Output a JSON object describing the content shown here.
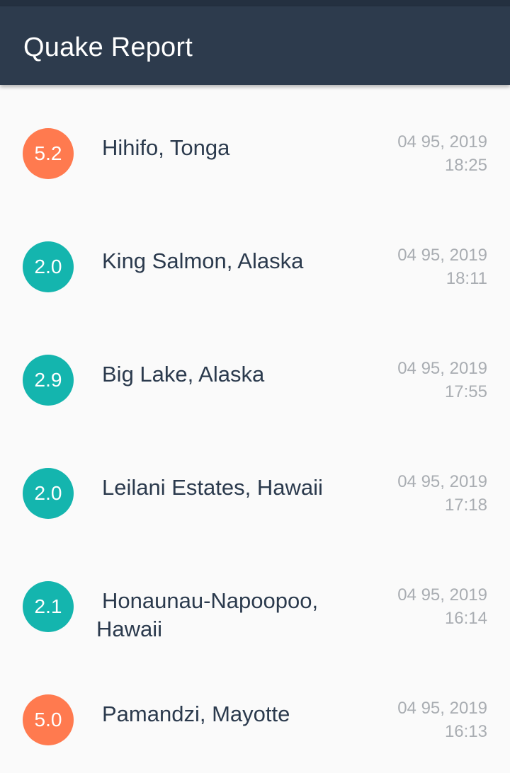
{
  "app": {
    "title": "Quake Report",
    "colors": {
      "app_bar": "#2d3b4d",
      "background": "#fafafa",
      "magnitude_orange": "#ff7a4f",
      "magnitude_teal": "#14b5ae",
      "place_text": "#2b3a4d",
      "date_text": "#a9adb2"
    }
  },
  "earthquakes": [
    {
      "magnitude": "5.2",
      "location": "Hihifo, Tonga",
      "date": "04 95, 2019",
      "time": "18:25",
      "color": "#ff7a4f"
    },
    {
      "magnitude": "2.0",
      "location": "King Salmon, Alaska",
      "date": "04 95, 2019",
      "time": "18:11",
      "color": "#14b5ae"
    },
    {
      "magnitude": "2.9",
      "location": "Big Lake, Alaska",
      "date": "04 95, 2019",
      "time": "17:55",
      "color": "#14b5ae"
    },
    {
      "magnitude": "2.0",
      "location": "Leilani Estates, Hawaii",
      "date": "04 95, 2019",
      "time": "17:18",
      "color": "#14b5ae"
    },
    {
      "magnitude": "2.1",
      "location": "Honaunau-Napoopoo, Hawaii",
      "date": "04 95, 2019",
      "time": "16:14",
      "color": "#14b5ae"
    },
    {
      "magnitude": "5.0",
      "location": "Pamandzi, Mayotte",
      "date": "04 95, 2019",
      "time": "16:13",
      "color": "#ff7a4f"
    }
  ]
}
